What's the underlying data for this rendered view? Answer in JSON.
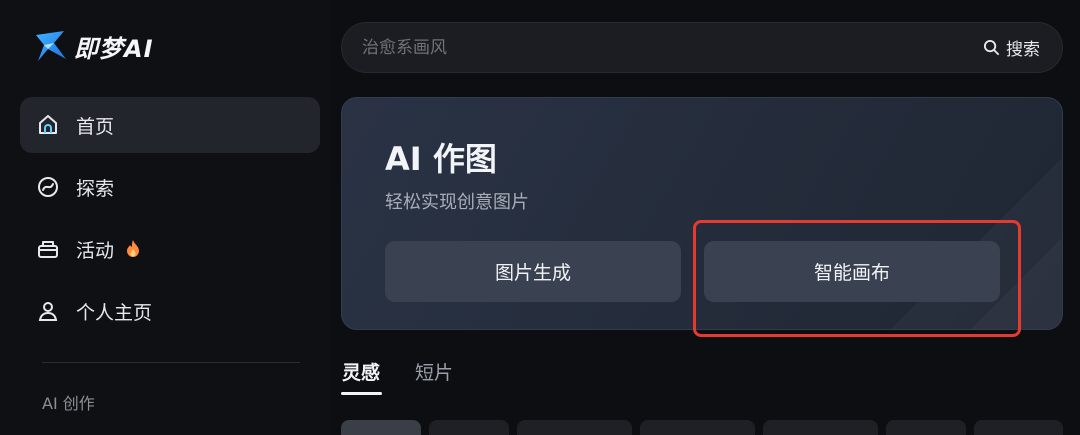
{
  "app": {
    "logo_text": "即梦AI"
  },
  "sidebar": {
    "items": [
      {
        "label": "首页",
        "icon": "home-icon",
        "active": true
      },
      {
        "label": "探索",
        "icon": "explore-icon",
        "active": false
      },
      {
        "label": "活动",
        "icon": "activity-icon",
        "badge": "fire-icon",
        "active": false
      },
      {
        "label": "个人主页",
        "icon": "user-icon",
        "active": false
      }
    ],
    "section_label": "AI 创作"
  },
  "search": {
    "placeholder": "治愈系画风",
    "button_label": "搜索"
  },
  "card": {
    "title": "AI 作图",
    "subtitle": "轻松实现创意图片",
    "buttons": [
      {
        "label": "图片生成"
      },
      {
        "label": "智能画布"
      }
    ]
  },
  "tabs": [
    {
      "label": "灵感",
      "active": true
    },
    {
      "label": "短片",
      "active": false
    }
  ],
  "colors": {
    "accent_highlight": "#e53a2f",
    "fire": "#ff8a3d",
    "background": "#0d0e11"
  }
}
